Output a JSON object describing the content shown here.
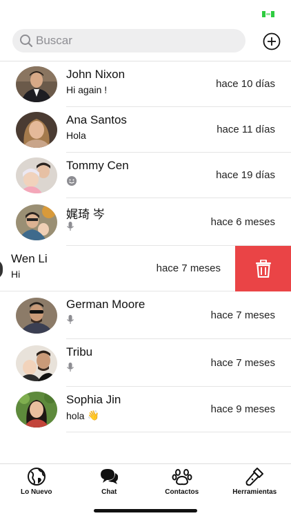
{
  "search": {
    "placeholder": "Buscar"
  },
  "chats": [
    {
      "name": "John Nixon",
      "preview": "Hi again !",
      "time": "hace 10 días"
    },
    {
      "name": "Ana Santos",
      "preview": "Hola",
      "time": "hace 11 días"
    },
    {
      "name": "Tommy Cen",
      "preview_icon": "emoji-face-icon",
      "time": "hace 19 días"
    },
    {
      "name": "娓琦 岑",
      "preview_icon": "microphone-icon",
      "time": "hace 6 meses"
    },
    {
      "name": "Wen Li",
      "preview": "Hi",
      "time": "hace 7 meses",
      "swipe_action": "trash-icon"
    },
    {
      "name": "German Moore",
      "preview_icon": "microphone-icon",
      "time": "hace 7 meses"
    },
    {
      "name": "Tribu",
      "preview_icon": "microphone-icon",
      "time": "hace 7 meses"
    },
    {
      "name": "Sophia Jin",
      "preview": "hola",
      "preview_emoji": "👋",
      "time": "hace 9 meses"
    }
  ],
  "tabs": [
    {
      "label": "Lo Nuevo",
      "icon": "globe-icon"
    },
    {
      "label": "Chat",
      "icon": "chat-bubbles-icon"
    },
    {
      "label": "Contactos",
      "icon": "paw-icon"
    },
    {
      "label": "Herramientas",
      "icon": "flashlight-icon"
    }
  ],
  "colors": {
    "delete": "#ea4446",
    "battery": "#2ecc40",
    "search_bg": "#eeeeef"
  }
}
